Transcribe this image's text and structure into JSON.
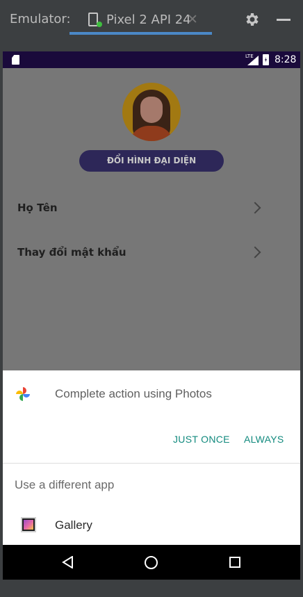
{
  "emulator": {
    "label": "Emulator:",
    "tab_title": "Pixel 2 API 24",
    "tab_close": "✕",
    "icons": {
      "device": "phone-device-icon",
      "settings": "gear-icon",
      "minimize": "minimize-icon"
    }
  },
  "status_bar": {
    "time": "8:28",
    "network": "LTE",
    "icons": [
      "sd-card-icon",
      "signal-icon",
      "battery-charging-icon"
    ]
  },
  "profile": {
    "change_avatar_button": "ĐỔI HÌNH ĐẠI DIỆN",
    "menu": [
      {
        "label": "Họ Tên"
      },
      {
        "label": "Thay đổi mật khẩu"
      }
    ]
  },
  "chooser": {
    "title": "Complete action using Photos",
    "just_once": "JUST ONCE",
    "always": "ALWAYS",
    "different_app": "Use a different app",
    "apps": [
      {
        "label": "Gallery",
        "icon": "gallery-icon"
      }
    ]
  },
  "nav_bar": {
    "buttons": [
      "back-icon",
      "home-icon",
      "recents-icon"
    ]
  },
  "colors": {
    "status_bar": "#1a0a3b",
    "accent_button": "#2d2758",
    "dialog_action": "#128a7e",
    "scrim": "#777777"
  }
}
